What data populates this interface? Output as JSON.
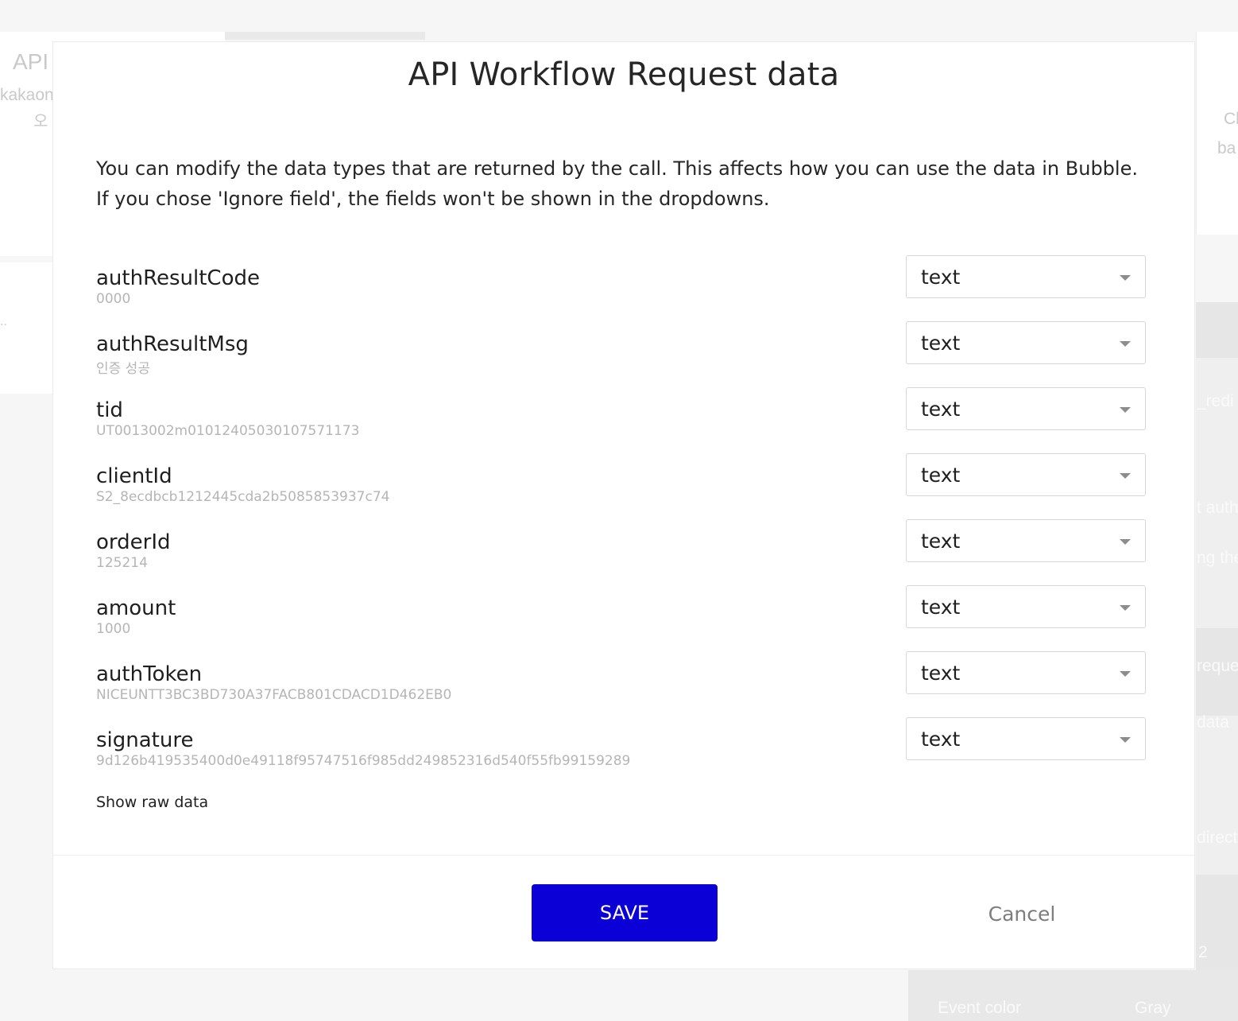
{
  "background": {
    "left_title": "API",
    "left_sub1": "kakaon",
    "left_sub2": "오",
    "left_ellipsis": "..",
    "right_fragments": [
      "Cl",
      "ba",
      "_redi",
      "t auth",
      "ng the",
      "reque",
      "data",
      "direct",
      "2"
    ],
    "bottom_left_label": "Event color",
    "bottom_right_value": "Gray"
  },
  "modal": {
    "title": "API Workflow Request data",
    "description": "You can modify the data types that are returned by the call. This affects how you can use the data in Bubble. If you chose 'Ignore field', the fields won't be shown in the dropdowns.",
    "fields": [
      {
        "name": "authResultCode",
        "example": "0000",
        "type": "text"
      },
      {
        "name": "authResultMsg",
        "example": "인증 성공",
        "type": "text"
      },
      {
        "name": "tid",
        "example": "UT0013002m01012405030107571173",
        "type": "text"
      },
      {
        "name": "clientId",
        "example": "S2_8ecdbcb1212445cda2b5085853937c74",
        "type": "text"
      },
      {
        "name": "orderId",
        "example": "125214",
        "type": "text"
      },
      {
        "name": "amount",
        "example": "1000",
        "type": "text"
      },
      {
        "name": "authToken",
        "example": "NICEUNTT3BC3BD730A37FACB801CDACD1D462EB0",
        "type": "text"
      },
      {
        "name": "signature",
        "example": "9d126b419535400d0e49118f95747516f985dd249852316d540f55fb99159289",
        "type": "text"
      }
    ],
    "show_raw_label": "Show raw data",
    "save_label": "SAVE",
    "cancel_label": "Cancel"
  },
  "colors": {
    "primary_button": "#0b00d6",
    "muted_text": "#b5b5b5"
  },
  "icons": {
    "dropdown_caret": "chevron-down-icon"
  }
}
